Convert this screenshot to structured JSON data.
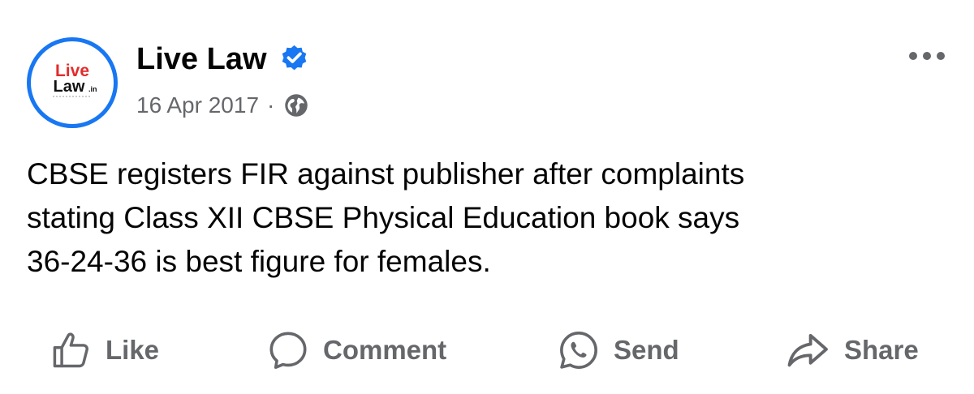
{
  "post": {
    "author": "Live Law",
    "avatar_text_top": "Live",
    "avatar_text_bottom": "Law",
    "avatar_text_suffix": ".in",
    "verified_icon": "verified-badge-icon",
    "date": "16 Apr 2017",
    "separator": "·",
    "audience_icon": "globe-icon",
    "more_icon": "more-options-icon",
    "text_lines": [
      "CBSE registers FIR against publisher after complaints",
      "stating Class XII CBSE Physical Education book says",
      "36-24-36 is best figure for females."
    ]
  },
  "actions": {
    "like": "Like",
    "comment": "Comment",
    "send": "Send",
    "share": "Share"
  },
  "colors": {
    "accent": "#1877f2",
    "secondary_text": "#65676b",
    "primary_text": "#050505",
    "logo_red": "#e32b2b"
  }
}
